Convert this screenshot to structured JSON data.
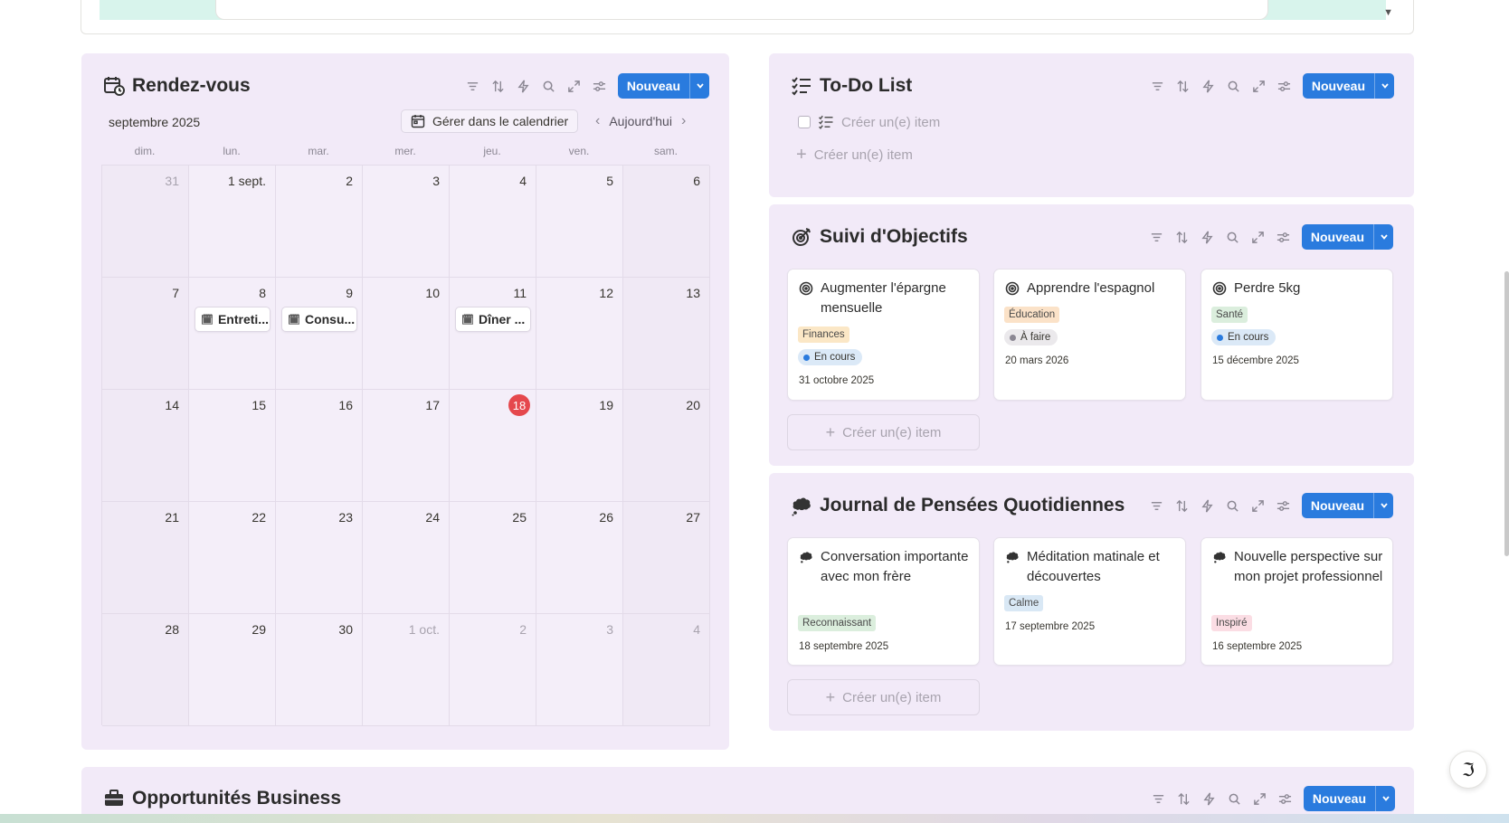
{
  "appointments": {
    "title": "Rendez-vous",
    "new_label": "Nouveau",
    "month": "septembre 2025",
    "manage_label": "Gérer dans le calendrier",
    "today_label": "Aujourd'hui",
    "weekdays": [
      "dim.",
      "lun.",
      "mar.",
      "mer.",
      "jeu.",
      "ven.",
      "sam."
    ],
    "days": [
      "31",
      "1 sept.",
      "2",
      "3",
      "4",
      "5",
      "6",
      "7",
      "8",
      "9",
      "10",
      "11",
      "12",
      "13",
      "14",
      "15",
      "16",
      "17",
      "18",
      "19",
      "20",
      "21",
      "22",
      "23",
      "24",
      "25",
      "26",
      "27",
      "28",
      "29",
      "30",
      "1 oct.",
      "2",
      "3",
      "4"
    ],
    "events": [
      "Entreti...",
      "Consu...",
      "Dîner ..."
    ]
  },
  "todo": {
    "title": "To-Do List",
    "new_label": "Nouveau",
    "create_placeholder": "Créer un(e) item",
    "create_label": "Créer un(e) item"
  },
  "goals": {
    "title": "Suivi d'Objectifs",
    "new_label": "Nouveau",
    "create_label": "Créer un(e) item",
    "cards": [
      {
        "title": "Augmenter l'épargne mensuelle",
        "tag": "Finances",
        "status": "En cours",
        "date": "31 octobre 2025"
      },
      {
        "title": "Apprendre l'espagnol",
        "tag": "Éducation",
        "status": "À faire",
        "date": "20 mars 2026"
      },
      {
        "title": "Perdre 5kg",
        "tag": "Santé",
        "status": "En cours",
        "date": "15 décembre 2025"
      }
    ]
  },
  "journal": {
    "title": "Journal de Pensées Quotidiennes",
    "new_label": "Nouveau",
    "create_label": "Créer un(e) item",
    "cards": [
      {
        "title": "Conversation importante avec mon frère",
        "tag": "Reconnaissant",
        "date": "18 septembre 2025"
      },
      {
        "title": "Méditation matinale et découvertes",
        "tag": "Calme",
        "date": "17 septembre 2025"
      },
      {
        "title": "Nouvelle perspective sur mon projet professionnel",
        "tag": "Inspiré",
        "date": "16 septembre 2025"
      }
    ]
  },
  "business": {
    "title": "Opportunités Business",
    "new_label": "Nouveau"
  },
  "colors": {
    "panel_bg": "#f2eaf8",
    "accent": "#2a7bde",
    "today": "#e5484d",
    "tag_finances": "#fbe7c6",
    "tag_education": "#fbe2c8",
    "tag_sante": "#dbeedd",
    "tag_reconnaissant": "#dbeedd",
    "tag_calme": "#d9e8f5",
    "tag_inspire": "#fbdde4",
    "status_in_progress": "#dbe9f7",
    "status_todo": "#ebe9ec"
  }
}
